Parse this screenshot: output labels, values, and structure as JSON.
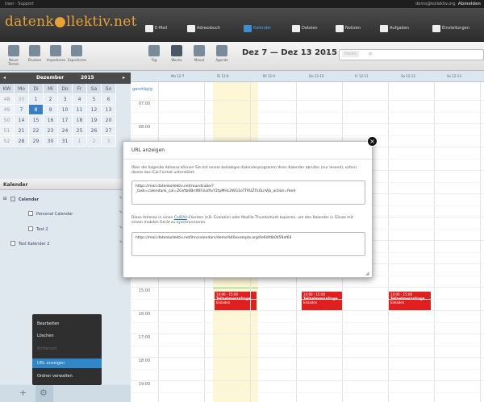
{
  "topbar": {
    "left": "User · Support",
    "right": "demo@kollektiv.org",
    "logout": "Abmelden"
  },
  "app": {
    "logo": "datenk●llektiv.net"
  },
  "nav": [
    {
      "label": "E-Mail",
      "icon": "mail-icon",
      "active": false
    },
    {
      "label": "Adressbuch",
      "icon": "addressbook-icon",
      "active": false
    },
    {
      "label": "Kalender",
      "icon": "calendar-icon",
      "active": true
    },
    {
      "label": "Dateien",
      "icon": "folder-icon",
      "active": false
    },
    {
      "label": "Notizen",
      "icon": "notes-icon",
      "active": false
    },
    {
      "label": "Aufgaben",
      "icon": "tasks-icon",
      "active": false
    },
    {
      "label": "Einstellungen",
      "icon": "gear-icon",
      "active": false
    }
  ],
  "toolbar": {
    "left_buttons": [
      "Neuer Termin",
      "Drucken",
      "Importieren",
      "Exportieren"
    ],
    "view_buttons": [
      "Tag",
      "Woche",
      "Monat",
      "Agenda"
    ],
    "daterange": "Dez 7 — Dez 13 2015",
    "today": "Heute"
  },
  "minical": {
    "month": "Dezember",
    "year": "2015",
    "weekdays": [
      "KW",
      "Mo",
      "Di",
      "Mi",
      "Do",
      "Fr",
      "Sa",
      "So"
    ],
    "weeks": [
      [
        "48",
        "30",
        "1",
        "2",
        "3",
        "4",
        "5",
        "6"
      ],
      [
        "49",
        "7",
        "8",
        "9",
        "10",
        "11",
        "12",
        "13"
      ],
      [
        "50",
        "14",
        "15",
        "16",
        "17",
        "18",
        "19",
        "20"
      ],
      [
        "51",
        "21",
        "22",
        "23",
        "24",
        "25",
        "26",
        "27"
      ],
      [
        "52",
        "28",
        "29",
        "30",
        "31",
        "1",
        "2",
        "3"
      ]
    ]
  },
  "calendars": {
    "title": "Kalender",
    "items": [
      {
        "label": "Calendar"
      },
      {
        "label": "Personal Calendar"
      },
      {
        "label": "Test 2"
      },
      {
        "label": "Test Kalender 2"
      }
    ]
  },
  "context_menu": {
    "items": [
      "Bearbeiten",
      "Löschen",
      "Entfernen",
      "URL anzeigen",
      "Ordner verwalten"
    ]
  },
  "week": {
    "allday": "ganztägig",
    "days": [
      "Mo 12-7",
      "Di 12-8",
      "Mi 12-9",
      "Do 12-10",
      "Fr 12-11",
      "Sa 12-12",
      "So 12-13"
    ],
    "hours": [
      "07:00",
      "08:00",
      "09:00",
      "10:00",
      "11:00",
      "12:00",
      "13:00",
      "14:00",
      "15:00",
      "16:00",
      "17:00",
      "18:00",
      "19:00"
    ]
  },
  "events": [
    {
      "time": "14:00 - 15:00",
      "title": "Teilnehmeranfrage",
      "note": "Einladen"
    },
    {
      "time": "14:00 - 15:00",
      "title": "Teilnehmeranfrage",
      "note": "Einladen"
    },
    {
      "time": "14:00 - 15:00",
      "title": "Teilnehmeranfrage",
      "note": "Einladen"
    }
  ],
  "dialog": {
    "title": "URL anzeigen",
    "text1": "Über die folgende Adresse können Sie mit einem beliebigen Kalenderprogramm Ihren Kalender abrufen (nur lesend), sofern dieses das iCal-Format unterstützt.",
    "url1": "https://mail.datenkollektiv.net/roundcube/?_task=calendar&_cal=ZGVtb0BrdWFsLkRvY2tpMHc2WG1oTTRUZTk0LnVjb_action=feed",
    "text2_pre": "Diese Adresse in einen ",
    "text2_link": "CalDAV",
    "text2_post": "-Clienten (z.B. Evolution oder Mozilla Thunderbird) kopieren, um den Kalender in Gänze mit einem mobilen Gerät zu synchronisieren.",
    "url2": "https://mail.datenkollektiv.net/ihn/calendars/demo%40example.org/0e6dfdb0059af64"
  }
}
